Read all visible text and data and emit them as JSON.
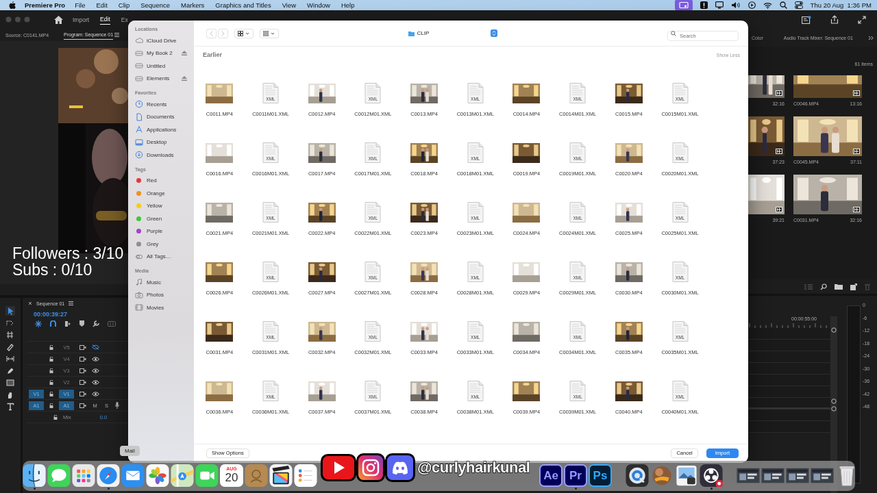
{
  "menubar": {
    "app": "Premiere Pro",
    "menus": [
      "File",
      "Edit",
      "Clip",
      "Sequence",
      "Markers",
      "Graphics and Titles",
      "View",
      "Window",
      "Help"
    ],
    "clock": "Thu 20 Aug  1:36 PM"
  },
  "premiere": {
    "workspaces": [
      {
        "label": "Import",
        "selected": false
      },
      {
        "label": "Edit",
        "selected": true
      },
      {
        "label": "Ex",
        "selected": false
      }
    ],
    "source_tab": "Source: C0141.MP4",
    "program_tab": "Program: Sequence 01",
    "timeline": {
      "title": "Sequence 01",
      "timecode": "00:00:39:27",
      "tracks": [
        {
          "label": "V5",
          "kind": "video",
          "targeted": false,
          "visible": false
        },
        {
          "label": "V4",
          "kind": "video",
          "targeted": false,
          "visible": true
        },
        {
          "label": "V3",
          "kind": "video",
          "targeted": false,
          "visible": true
        },
        {
          "label": "V2",
          "kind": "video",
          "targeted": false,
          "visible": true
        },
        {
          "label": "V1",
          "source": "V1",
          "kind": "video",
          "targeted": true,
          "visible": true
        },
        {
          "label": "A1",
          "source": "A1",
          "kind": "audio",
          "targeted": true,
          "mute": "M",
          "solo": "S"
        }
      ],
      "mix_label": "Mix",
      "mix_value": "0.0",
      "ruler_time": "00:00:55:00"
    },
    "right_tabs": [
      "Color",
      "Audio Track Mixer: Sequence 01"
    ],
    "item_count": "61 items",
    "bin_items": [
      {
        "duration": "32:16"
      },
      {
        "name": "C0046.MP4",
        "duration": "13:16"
      },
      {
        "duration": "37:23"
      },
      {
        "name": "C0045.MP4",
        "duration": "37:11"
      },
      {
        "duration": "39:21"
      },
      {
        "name": "C0031.MP4",
        "duration": "32:16"
      }
    ],
    "meter_ticks": [
      "0",
      "-6",
      "-12",
      "-18",
      "-24",
      "-30",
      "-36",
      "-42",
      "-48"
    ]
  },
  "overlay": {
    "stats": [
      "Followers : 3/10",
      "Subs : 0/10"
    ],
    "handle": "@curlyhairkunal"
  },
  "dialog": {
    "sidebar": [
      {
        "heading": "Locations",
        "items": [
          {
            "label": "iCloud Drive",
            "kind": "cloud",
            "eject": false
          },
          {
            "label": "My Book 2",
            "kind": "drive",
            "eject": true
          },
          {
            "label": "Untitled",
            "kind": "drive",
            "eject": false
          },
          {
            "label": "Elements",
            "kind": "drive",
            "eject": true
          }
        ]
      },
      {
        "heading": "Favorites",
        "items": [
          {
            "label": "Recents",
            "kind": "clock"
          },
          {
            "label": "Documents",
            "kind": "doc"
          },
          {
            "label": "Applications",
            "kind": "apps"
          },
          {
            "label": "Desktop",
            "kind": "desktop"
          },
          {
            "label": "Downloads",
            "kind": "download"
          }
        ]
      },
      {
        "heading": "Tags",
        "items": [
          {
            "label": "Red",
            "kind": "tag",
            "color": "#e2393e"
          },
          {
            "label": "Orange",
            "kind": "tag",
            "color": "#f0901c"
          },
          {
            "label": "Yellow",
            "kind": "tag",
            "color": "#f5cc1a"
          },
          {
            "label": "Green",
            "kind": "tag",
            "color": "#3ec83e"
          },
          {
            "label": "Purple",
            "kind": "tag",
            "color": "#a443c8"
          },
          {
            "label": "Grey",
            "kind": "tag",
            "color": "#8e8e93"
          },
          {
            "label": "All Tags…",
            "kind": "alltags"
          }
        ]
      },
      {
        "heading": "Media",
        "items": [
          {
            "label": "Music",
            "kind": "music"
          },
          {
            "label": "Photos",
            "kind": "camera"
          },
          {
            "label": "Movies",
            "kind": "film"
          }
        ]
      }
    ],
    "back_enabled": false,
    "forward_enabled": false,
    "location": "CLIP",
    "search_placeholder": "Search",
    "section": "Earlier",
    "section_toggle": "Show Less",
    "files": [
      {
        "name": "C0011.MP4",
        "kind": "video"
      },
      {
        "name": "C0011M01.XML",
        "kind": "xml",
        "icon_label": "XML"
      },
      {
        "name": "C0012.MP4",
        "kind": "video"
      },
      {
        "name": "C0012M01.XML",
        "kind": "xml",
        "icon_label": "XML"
      },
      {
        "name": "C0013.MP4",
        "kind": "video"
      },
      {
        "name": "C0013M01.XML",
        "kind": "xml",
        "icon_label": "XML"
      },
      {
        "name": "C0014.MP4",
        "kind": "video"
      },
      {
        "name": "C0014M01.XML",
        "kind": "xml",
        "icon_label": "XML"
      },
      {
        "name": "C0015.MP4",
        "kind": "video"
      },
      {
        "name": "C0015M01.XML",
        "kind": "xml",
        "icon_label": "XML"
      },
      {
        "name": "C0016.MP4",
        "kind": "video"
      },
      {
        "name": "C0016M01.XML",
        "kind": "xml",
        "icon_label": "XML"
      },
      {
        "name": "C0017.MP4",
        "kind": "video"
      },
      {
        "name": "C0017M01.XML",
        "kind": "xml",
        "icon_label": "XML"
      },
      {
        "name": "C0018.MP4",
        "kind": "video"
      },
      {
        "name": "C0018M01.XML",
        "kind": "xml",
        "icon_label": "XML"
      },
      {
        "name": "C0019.MP4",
        "kind": "video"
      },
      {
        "name": "C0019M01.XML",
        "kind": "xml",
        "icon_label": "XML"
      },
      {
        "name": "C0020.MP4",
        "kind": "video"
      },
      {
        "name": "C0020M01.XML",
        "kind": "xml",
        "icon_label": "XML"
      },
      {
        "name": "C0021.MP4",
        "kind": "video"
      },
      {
        "name": "C0021M01.XML",
        "kind": "xml",
        "icon_label": "XML"
      },
      {
        "name": "C0022.MP4",
        "kind": "video"
      },
      {
        "name": "C0022M01.XML",
        "kind": "xml",
        "icon_label": "XML"
      },
      {
        "name": "C0023.MP4",
        "kind": "video"
      },
      {
        "name": "C0023M01.XML",
        "kind": "xml",
        "icon_label": "XML"
      },
      {
        "name": "C0024.MP4",
        "kind": "video"
      },
      {
        "name": "C0024M01.XML",
        "kind": "xml",
        "icon_label": "XML"
      },
      {
        "name": "C0025.MP4",
        "kind": "video"
      },
      {
        "name": "C0025M01.XML",
        "kind": "xml",
        "icon_label": "XML"
      },
      {
        "name": "C0026.MP4",
        "kind": "video"
      },
      {
        "name": "C0026M01.XML",
        "kind": "xml",
        "icon_label": "XML"
      },
      {
        "name": "C0027.MP4",
        "kind": "video"
      },
      {
        "name": "C0027M01.XML",
        "kind": "xml",
        "icon_label": "XML"
      },
      {
        "name": "C0028.MP4",
        "kind": "video"
      },
      {
        "name": "C0028M01.XML",
        "kind": "xml",
        "icon_label": "XML"
      },
      {
        "name": "C0029.MP4",
        "kind": "video"
      },
      {
        "name": "C0029M01.XML",
        "kind": "xml",
        "icon_label": "XML"
      },
      {
        "name": "C0030.MP4",
        "kind": "video"
      },
      {
        "name": "C0030M01.XML",
        "kind": "xml",
        "icon_label": "XML"
      },
      {
        "name": "C0031.MP4",
        "kind": "video"
      },
      {
        "name": "C0031M01.XML",
        "kind": "xml",
        "icon_label": "XML"
      },
      {
        "name": "C0032.MP4",
        "kind": "video"
      },
      {
        "name": "C0032M01.XML",
        "kind": "xml",
        "icon_label": "XML"
      },
      {
        "name": "C0033.MP4",
        "kind": "video"
      },
      {
        "name": "C0033M01.XML",
        "kind": "xml",
        "icon_label": "XML"
      },
      {
        "name": "C0034.MP4",
        "kind": "video"
      },
      {
        "name": "C0034M01.XML",
        "kind": "xml",
        "icon_label": "XML"
      },
      {
        "name": "C0035.MP4",
        "kind": "video"
      },
      {
        "name": "C0035M01.XML",
        "kind": "xml",
        "icon_label": "XML"
      },
      {
        "name": "C0036.MP4",
        "kind": "video"
      },
      {
        "name": "C0036M01.XML",
        "kind": "xml",
        "icon_label": "XML"
      },
      {
        "name": "C0037.MP4",
        "kind": "video"
      },
      {
        "name": "C0037M01.XML",
        "kind": "xml",
        "icon_label": "XML"
      },
      {
        "name": "C0038.MP4",
        "kind": "video"
      },
      {
        "name": "C0038M01.XML",
        "kind": "xml",
        "icon_label": "XML"
      },
      {
        "name": "C0039.MP4",
        "kind": "video"
      },
      {
        "name": "C0039M01.XML",
        "kind": "xml",
        "icon_label": "XML"
      },
      {
        "name": "C0040.MP4",
        "kind": "video"
      },
      {
        "name": "C0040M01.XML",
        "kind": "xml",
        "icon_label": "XML"
      }
    ],
    "options_button": "Show Options",
    "cancel_button": "Cancel",
    "confirm_button": "Import"
  },
  "dock": {
    "sections": [
      {
        "items": [
          {
            "kind": "finder",
            "running": true
          },
          {
            "kind": "messages",
            "running": false
          },
          {
            "kind": "launchpad",
            "running": false
          },
          {
            "kind": "safari",
            "running": true
          },
          {
            "kind": "mail",
            "running": false,
            "tooltip": "Mail"
          },
          {
            "kind": "photos",
            "running": false
          },
          {
            "kind": "maps",
            "running": false
          },
          {
            "kind": "facetime",
            "running": false
          },
          {
            "kind": "calendar",
            "running": false,
            "month": "AUG",
            "day": "20"
          },
          {
            "kind": "contacts",
            "running": false
          },
          {
            "kind": "clapper",
            "running": false
          },
          {
            "kind": "reminders",
            "running": false
          }
        ]
      },
      {
        "items": [
          {
            "kind": "adobe",
            "label": "Ae",
            "color": "#9999ff",
            "running": false
          },
          {
            "kind": "adobe",
            "label": "Pr",
            "color": "#9999ff",
            "running": true
          },
          {
            "kind": "adobe",
            "label": "Ps",
            "color": "#31a8ff",
            "running": false
          }
        ]
      },
      {
        "items": [
          {
            "kind": "quicktime",
            "running": false
          },
          {
            "kind": "ball",
            "running": false
          },
          {
            "kind": "preview",
            "running": false
          },
          {
            "kind": "obs",
            "running": true
          }
        ]
      },
      {
        "items": [
          {
            "kind": "window",
            "running": false
          },
          {
            "kind": "window",
            "running": false
          },
          {
            "kind": "window",
            "running": false
          },
          {
            "kind": "window",
            "running": false
          },
          {
            "kind": "trash",
            "running": false
          }
        ]
      }
    ]
  }
}
